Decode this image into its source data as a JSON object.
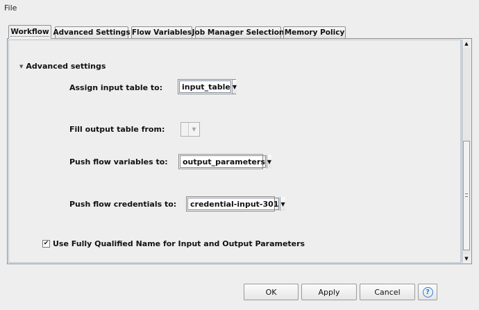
{
  "menubar": {
    "file_label": "File"
  },
  "tabs": [
    {
      "label": "Workflow",
      "active": true
    },
    {
      "label": "Advanced Settings",
      "active": false
    },
    {
      "label": "Flow Variables",
      "active": false
    },
    {
      "label": "Job Manager Selection",
      "active": false
    },
    {
      "label": "Memory Policy",
      "active": false
    }
  ],
  "section": {
    "title": "Advanced settings",
    "expanded": true
  },
  "fields": {
    "assign_input": {
      "label": "Assign input table to:",
      "value": "input_table"
    },
    "fill_output": {
      "label": "Fill output table from:",
      "value": ""
    },
    "push_flow_vars": {
      "label": "Push flow variables to:",
      "value": "output_parameters"
    },
    "push_credentials": {
      "label": "Push flow credentials to:",
      "value": "credential-input-301"
    }
  },
  "checkbox": {
    "label": "Use Fully Qualified Name for Input and Output Parameters",
    "checked": true
  },
  "buttons": {
    "ok": "OK",
    "apply": "Apply",
    "cancel": "Cancel",
    "help": "?"
  },
  "icons": {
    "section_toggle": "caret-down-icon",
    "combo_arrow": "triangle-down-icon",
    "help": "help-icon"
  },
  "colors": {
    "background": "#eeeeee",
    "help_blue": "#2a7fd4"
  }
}
